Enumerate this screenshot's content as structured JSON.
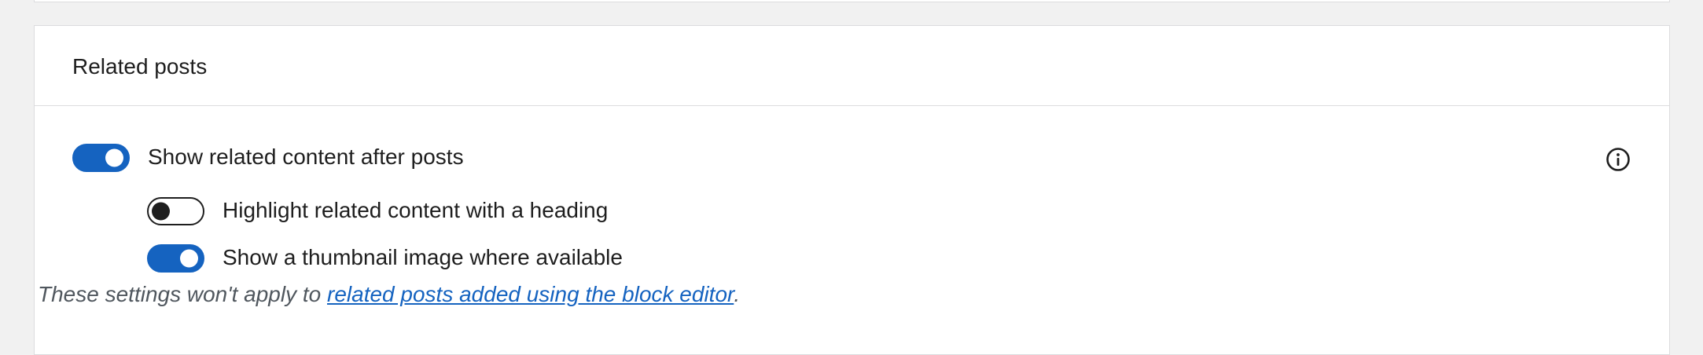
{
  "section": {
    "title": "Related posts"
  },
  "settings": {
    "main": {
      "label": "Show related content after posts",
      "enabled": true
    },
    "highlight": {
      "label": "Highlight related content with a heading",
      "enabled": false
    },
    "thumbnail": {
      "label": "Show a thumbnail image where available",
      "enabled": true
    }
  },
  "note": {
    "prefix": "These settings won't apply to ",
    "link_text": "related posts added using the block editor",
    "suffix": "."
  },
  "icons": {
    "info": "info-icon"
  },
  "colors": {
    "accent": "#1563c0",
    "text": "#1e1e1e",
    "muted": "#50575e",
    "border": "#dcdcde",
    "background": "#f1f1f1"
  }
}
